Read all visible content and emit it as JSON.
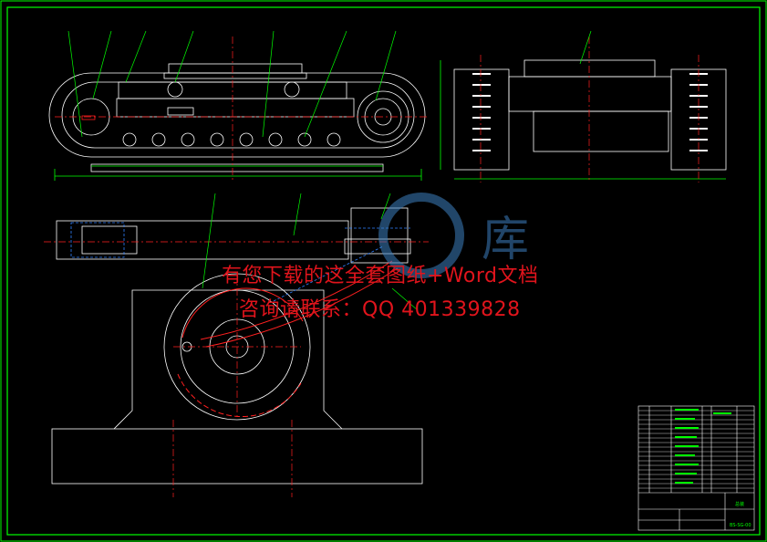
{
  "drawing": {
    "frame_color": "#00ff00",
    "line_color": "#ffffff",
    "centerline_color": "#ff2020",
    "leader_color": "#00ff00",
    "dimension_color": "#00ff00"
  },
  "watermark": {
    "line1": "有您下载的这全套图纸+Word文档",
    "line2": "咨询请联系：QQ 401339828",
    "color": "#e0141c",
    "logo_char": "库"
  },
  "title_block": {
    "drawing_no": "BS-SG-00",
    "name": "总装"
  }
}
